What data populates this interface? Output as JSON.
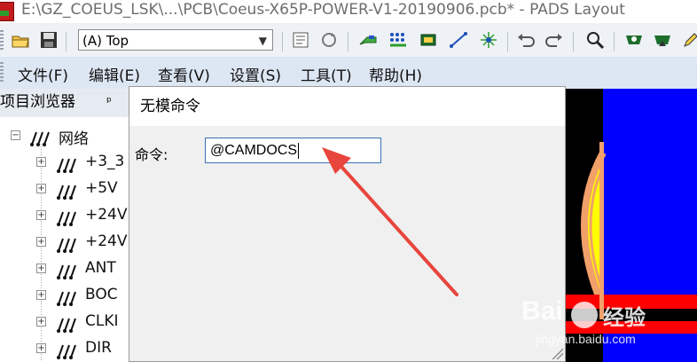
{
  "window": {
    "title": "E:\\GZ_COEUS_LSK\\...\\PCB\\Coeus-X65P-POWER-V1-20190906.pcb* - PADS Layout",
    "app_icon": "pads-app-icon"
  },
  "toolbar": {
    "layer_value": "(A) Top",
    "icons": [
      "open-folder-icon",
      "save-icon",
      "properties-icon",
      "refresh-icon",
      "route-icon",
      "matrix-icon",
      "component-icon",
      "diagonal-line-icon",
      "starburst-icon",
      "undo-icon",
      "redo-icon",
      "zoom-icon",
      "view-icon",
      "eye-icon",
      "edit-icon"
    ]
  },
  "menu": {
    "items": [
      "文件(F)",
      "编辑(E)",
      "查看(V)",
      "设置(S)",
      "工具(T)",
      "帮助(H)"
    ]
  },
  "project_browser": {
    "title": "项目浏览器",
    "pin_glyph": "ᵖ",
    "tree": [
      {
        "label": "网络",
        "expander": "−"
      },
      {
        "label": "+3_3",
        "expander": "+"
      },
      {
        "label": "+5V",
        "expander": "+"
      },
      {
        "label": "+24V",
        "expander": "+"
      },
      {
        "label": "+24V",
        "expander": "+"
      },
      {
        "label": "ANT",
        "expander": "+"
      },
      {
        "label": "BOC",
        "expander": "+"
      },
      {
        "label": "CLKI",
        "expander": "+"
      },
      {
        "label": "DIR",
        "expander": "+"
      }
    ]
  },
  "dialog": {
    "title": "无模命令",
    "command_label": "命令:",
    "command_value": "@CAMDOCS"
  },
  "watermark": {
    "brand": "Bai",
    "brand_suffix": "经验",
    "url": "jingyan.baidu.com"
  },
  "colors": {
    "annotation_arrow": "#e8453c",
    "canvas_bg": "#000000",
    "canvas_blue": "#0000ff",
    "canvas_yellow": "#ffff00",
    "canvas_red": "#ff0000",
    "canvas_orange": "#f2a06a"
  }
}
